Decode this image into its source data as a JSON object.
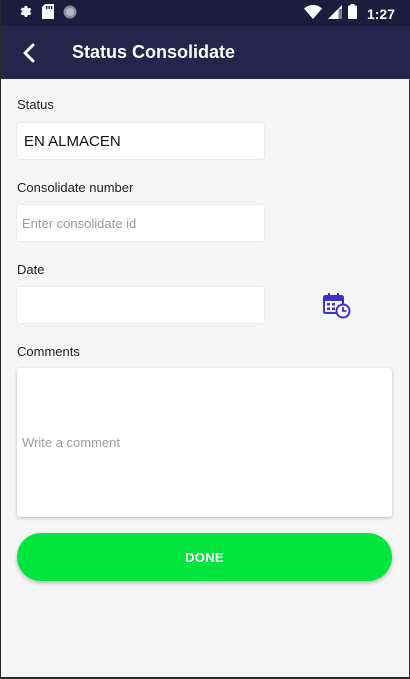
{
  "status_bar": {
    "time": "1:27",
    "left_icons": [
      "gear-icon",
      "sd-card-icon",
      "circle-icon"
    ],
    "right_icons": [
      "wifi-icon",
      "signal-icon",
      "battery-icon"
    ]
  },
  "app_bar": {
    "title": "Status Consolidate",
    "back_icon": "back-arrow-icon",
    "background": "#26244a"
  },
  "form": {
    "status": {
      "label": "Status",
      "value": "EN ALMACEN"
    },
    "consolidate": {
      "label": "Consolidate number",
      "value": "",
      "placeholder": "Enter consolidate id"
    },
    "date": {
      "label": "Date",
      "value": "",
      "icon": "calendar-clock-icon"
    },
    "comments": {
      "label": "Comments",
      "value": "",
      "placeholder": "Write a comment"
    }
  },
  "done_button": {
    "label": "DONE",
    "color": "#00e63f"
  },
  "colors": {
    "accent": "#3d2fd0",
    "background": "#f6f6f6"
  }
}
